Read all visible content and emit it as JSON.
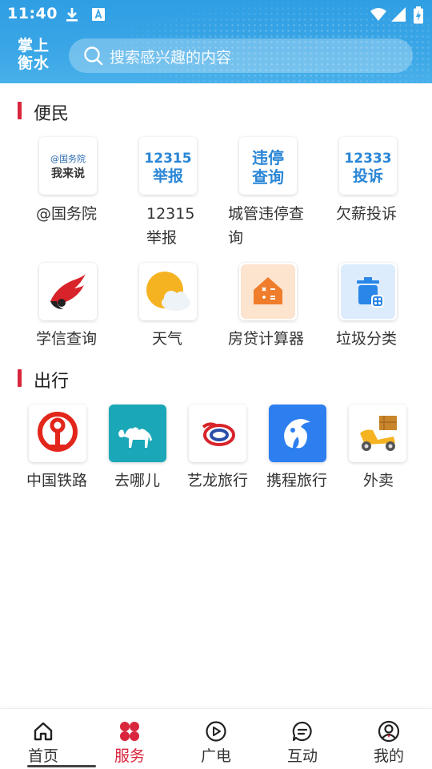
{
  "status_bar": {
    "time": "11:40"
  },
  "header": {
    "logo_line1": "掌上",
    "logo_line2": "衡水",
    "search_placeholder": "搜索感兴趣的内容"
  },
  "sections": {
    "bianmin": {
      "title": "便民",
      "items": [
        {
          "label": "@国务院",
          "icon_text_top": "@国务院",
          "icon_text_bottom": "我来说"
        },
        {
          "label_line1": "12315",
          "label_line2": "举报",
          "icon_text_top": "12315",
          "icon_text_bottom": "举报"
        },
        {
          "label_line1": "城管违停查",
          "label_line2": "询",
          "icon_text_top": "违停",
          "icon_text_bottom": "查询"
        },
        {
          "label": "欠薪投诉",
          "icon_text_top": "12333",
          "icon_text_bottom": "投诉"
        },
        {
          "label": "学信查询",
          "icon": "xuexin-logo-icon"
        },
        {
          "label": "天气",
          "icon": "weather-sun-cloud-icon"
        },
        {
          "label": "房贷计算器",
          "icon": "house-calculator-icon"
        },
        {
          "label": "垃圾分类",
          "icon": "trash-bin-icon"
        }
      ]
    },
    "chuxing": {
      "title": "出行",
      "items": [
        {
          "label": "中国铁路",
          "icon": "china-railway-logo-icon"
        },
        {
          "label": "去哪儿",
          "icon": "qunar-camel-icon"
        },
        {
          "label": "艺龙旅行",
          "icon": "elong-dragon-icon"
        },
        {
          "label": "携程旅行",
          "icon": "ctrip-dolphin-icon"
        },
        {
          "label": "外卖",
          "icon": "delivery-scooter-icon"
        }
      ]
    }
  },
  "bottom_nav": [
    {
      "label": "首页",
      "icon": "home-icon",
      "active": false
    },
    {
      "label": "服务",
      "icon": "services-grid-icon",
      "active": true
    },
    {
      "label": "广电",
      "icon": "play-circle-icon",
      "active": false
    },
    {
      "label": "互动",
      "icon": "chat-bubble-icon",
      "active": false
    },
    {
      "label": "我的",
      "icon": "user-circle-icon",
      "active": false
    }
  ],
  "colors": {
    "accent": "#d9263c",
    "header_blue": "#3aa6e6"
  }
}
